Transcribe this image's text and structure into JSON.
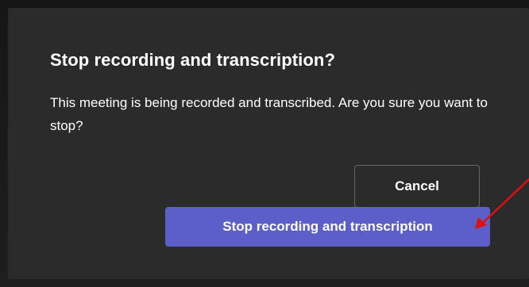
{
  "dialog": {
    "title": "Stop recording and transcription?",
    "message": "This meeting is being recorded and transcribed. Are you sure you want to stop?",
    "cancel_label": "Cancel",
    "confirm_label": "Stop recording and transcription"
  },
  "colors": {
    "dialog_background": "#2b2b2b",
    "primary_button": "#5b5fc7",
    "annotation_arrow": "#e01010"
  },
  "annotation": {
    "icon": "red-arrow-icon"
  }
}
